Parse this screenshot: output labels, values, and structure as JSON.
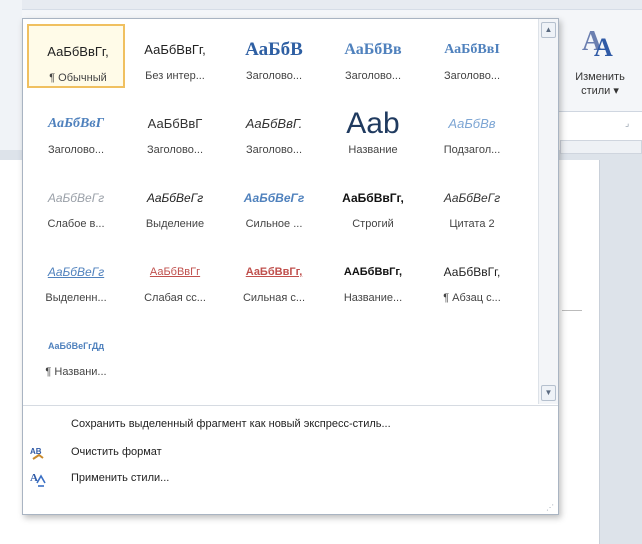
{
  "ribbon": {
    "change_styles": {
      "line1": "Изменить",
      "line2": "стили ▾"
    }
  },
  "gallery": {
    "tiles": [
      {
        "sample": "АаБбВвГг,",
        "name": "¶ Обычный",
        "selected": true,
        "color": "#222222",
        "font": "sans",
        "size": 13,
        "weight": "normal",
        "style": "normal",
        "decoration": "none"
      },
      {
        "sample": "АаБбВвГг,",
        "name": "Без интер...",
        "color": "#222222",
        "font": "sans",
        "size": 13,
        "weight": "normal",
        "style": "normal",
        "decoration": "none"
      },
      {
        "sample": "АаБбВ",
        "name": "Заголово...",
        "color": "#2e5fa3",
        "font": "serif",
        "size": 19,
        "weight": "bold",
        "style": "normal",
        "decoration": "none"
      },
      {
        "sample": "АаБбВв",
        "name": "Заголово...",
        "color": "#4f81bd",
        "font": "serif",
        "size": 16,
        "weight": "bold",
        "style": "normal",
        "decoration": "none"
      },
      {
        "sample": "АаБбВвІ",
        "name": "Заголово...",
        "color": "#4f81bd",
        "font": "serif",
        "size": 14,
        "weight": "bold",
        "style": "normal",
        "decoration": "none"
      },
      {
        "sample": "АаБбВвГ",
        "name": "Заголово...",
        "color": "#4f81bd",
        "font": "serif",
        "size": 14,
        "weight": "bold",
        "style": "italic",
        "decoration": "none"
      },
      {
        "sample": "АаБбВвГ",
        "name": "Заголово...",
        "color": "#333333",
        "font": "sans",
        "size": 13,
        "weight": "normal",
        "style": "normal",
        "decoration": "none"
      },
      {
        "sample": "АаБбВвГ.",
        "name": "Заголово...",
        "color": "#333333",
        "font": "sans",
        "size": 13,
        "weight": "normal",
        "style": "italic",
        "decoration": "none"
      },
      {
        "sample": "Аab",
        "name": "Название",
        "color": "#1f3a5f",
        "font": "sans",
        "size": 30,
        "weight": "normal",
        "style": "normal",
        "decoration": "none"
      },
      {
        "sample": "АаБбВв",
        "name": "Подзагол...",
        "color": "#7ea6d4",
        "font": "sans",
        "size": 13,
        "weight": "normal",
        "style": "italic",
        "decoration": "none"
      },
      {
        "sample": "АаБбВеГг",
        "name": "Слабое в...",
        "color": "#9aa0a8",
        "font": "sans",
        "size": 12,
        "weight": "normal",
        "style": "italic",
        "decoration": "none"
      },
      {
        "sample": "АаБбВеГг",
        "name": "Выделение",
        "color": "#222222",
        "font": "sans",
        "size": 12,
        "weight": "normal",
        "style": "italic",
        "decoration": "none"
      },
      {
        "sample": "АаБбВеГг",
        "name": "Сильное ...",
        "color": "#4f81bd",
        "font": "sans",
        "size": 12,
        "weight": "bold",
        "style": "italic",
        "decoration": "none"
      },
      {
        "sample": "АаБбВвГг,",
        "name": "Строгий",
        "color": "#111111",
        "font": "sans",
        "size": 12,
        "weight": "bold",
        "style": "normal",
        "decoration": "none"
      },
      {
        "sample": "АаБбВеГг",
        "name": "Цитата 2",
        "color": "#333333",
        "font": "sans",
        "size": 12,
        "weight": "normal",
        "style": "italic",
        "decoration": "none"
      },
      {
        "sample": "АаБбВеГг",
        "name": "Выделенн...",
        "color": "#4f81bd",
        "font": "sans",
        "size": 12,
        "weight": "normal",
        "style": "italic",
        "decoration": "underline"
      },
      {
        "sample": "АаБбВвГг",
        "name": "Слабая сс...",
        "color": "#c0504d",
        "font": "sans",
        "size": 11,
        "weight": "normal",
        "style": "normal",
        "decoration": "underline"
      },
      {
        "sample": "АаБбВвГг,",
        "name": "Сильная с...",
        "color": "#c0504d",
        "font": "sans",
        "size": 11,
        "weight": "bold",
        "style": "normal",
        "decoration": "underline"
      },
      {
        "sample": "ААБбВвГг,",
        "name": "Название...",
        "color": "#111111",
        "font": "sans",
        "size": 11,
        "weight": "bold",
        "style": "normal",
        "decoration": "none"
      },
      {
        "sample": "АаБбВвГг,",
        "name": "¶ Абзац с...",
        "color": "#222222",
        "font": "sans",
        "size": 12,
        "weight": "normal",
        "style": "normal",
        "decoration": "none"
      },
      {
        "sample": "АаБбВеГгДд",
        "name": "¶ Названи...",
        "color": "#4f81bd",
        "font": "sans",
        "size": 9,
        "weight": "bold",
        "style": "normal",
        "decoration": "none"
      }
    ]
  },
  "commands": [
    {
      "label": "Сохранить выделенный фрагмент как новый экспресс-стиль...",
      "icon": "none"
    },
    {
      "label": "Очистить формат",
      "icon": "clear-format-icon"
    },
    {
      "label": "Применить стили...",
      "icon": "apply-styles-icon"
    }
  ],
  "scrollbar": {
    "up": "▲",
    "down": "▼"
  }
}
